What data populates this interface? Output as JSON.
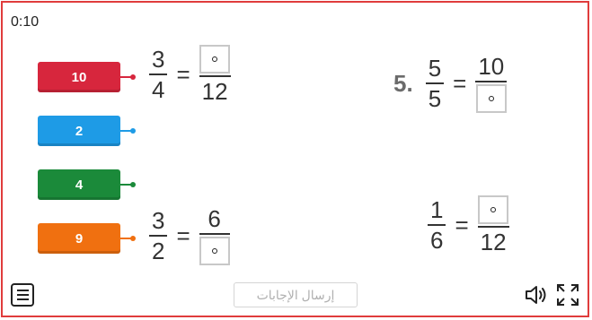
{
  "timer": "0:10",
  "chips": [
    {
      "label": "10",
      "color": "#d7263d"
    },
    {
      "label": "2",
      "color": "#1e9be6"
    },
    {
      "label": "4",
      "color": "#1b8a3a"
    },
    {
      "label": "9",
      "color": "#f07010"
    }
  ],
  "equations": {
    "q1": {
      "left_num": "3",
      "left_den": "4",
      "equals": "=",
      "right_den": "12"
    },
    "q2": {
      "number": "5.",
      "left_num": "5",
      "left_den": "5",
      "equals": "=",
      "right_num": "10"
    },
    "q3": {
      "left_num": "3",
      "left_den": "2",
      "equals": "=",
      "right_num": "6"
    },
    "q4": {
      "left_num": "1",
      "left_den": "6",
      "equals": "=",
      "right_den": "12"
    }
  },
  "footer": {
    "submit_label": "إرسال الإجابات",
    "menu_icon": "menu-icon",
    "sound_icon": "speaker-icon",
    "fullscreen_icon": "fullscreen-icon"
  }
}
